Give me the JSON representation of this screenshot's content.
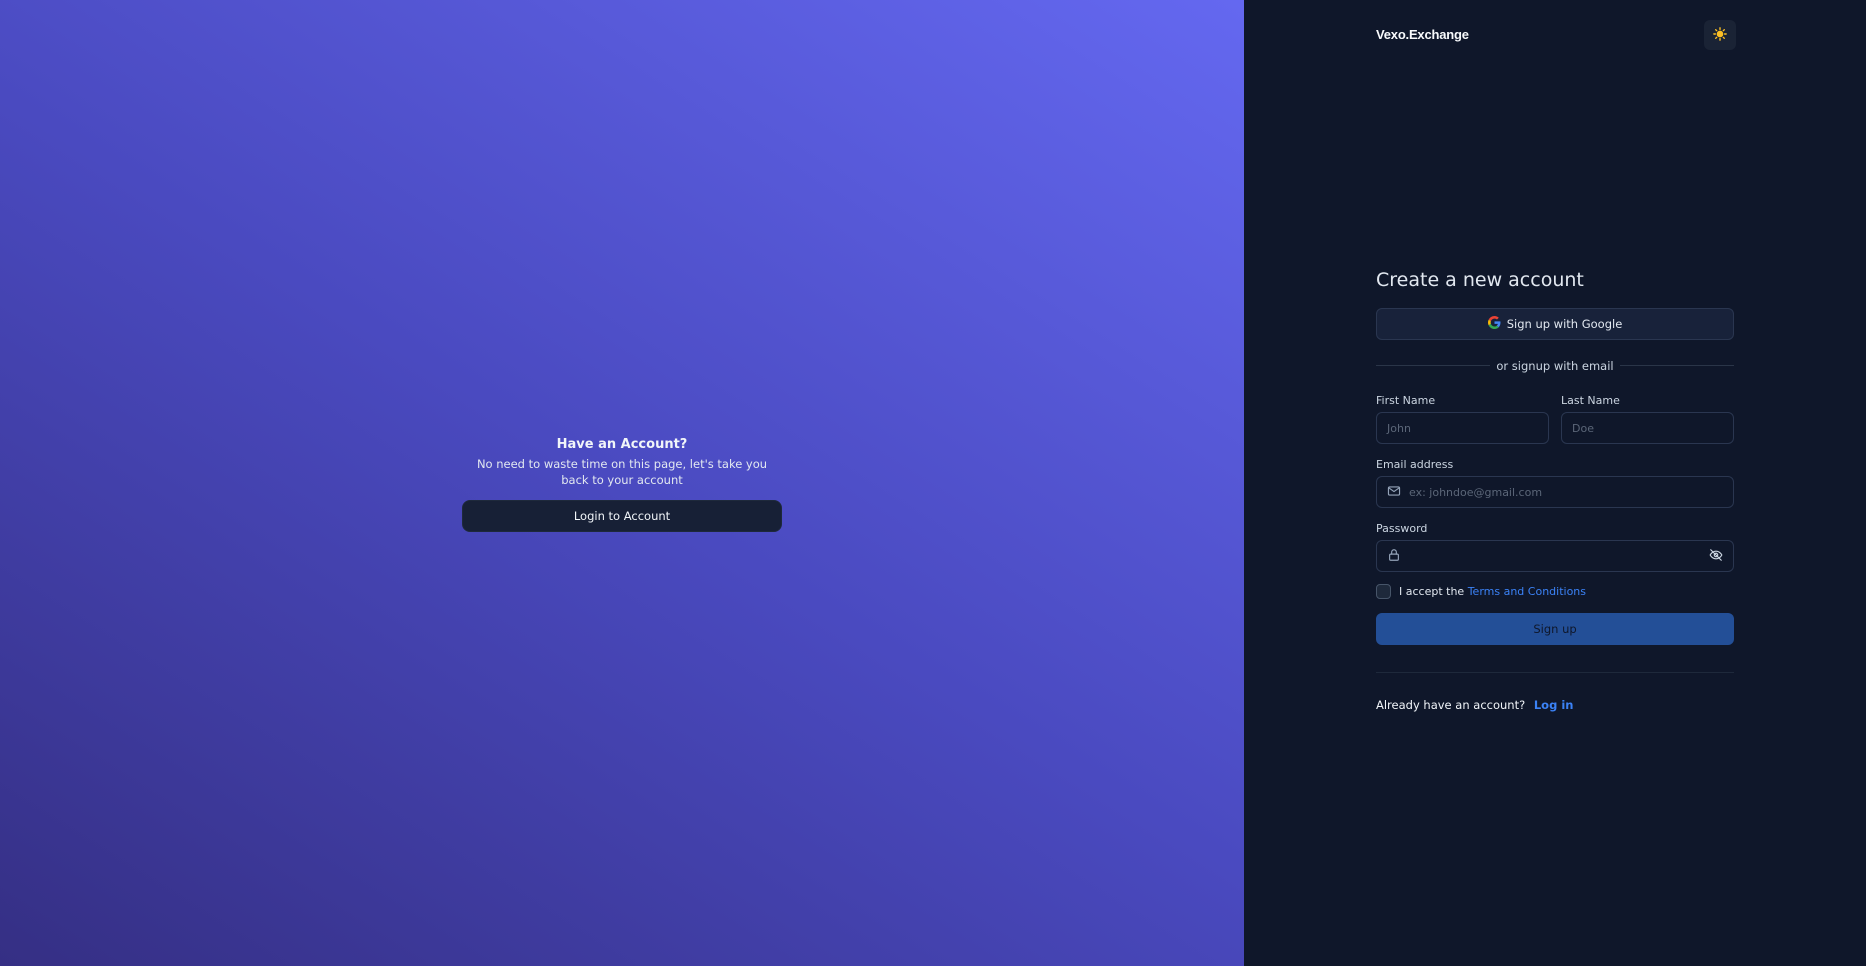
{
  "promo": {
    "title": "Have an Account?",
    "text": "No need to waste time on this page, let's take you back to your account",
    "button": "Login to Account"
  },
  "header": {
    "brand": "Vexo.Exchange",
    "theme_icon": "sun-icon"
  },
  "form": {
    "title": "Create a new account",
    "google_button": "Sign up with Google",
    "divider": "or signup with email",
    "first_name_label": "First Name",
    "first_name_placeholder": "John",
    "last_name_label": "Last Name",
    "last_name_placeholder": "Doe",
    "email_label": "Email address",
    "email_placeholder": "ex: johndoe@gmail.com",
    "password_label": "Password",
    "password_value": "",
    "terms_prefix": "I accept the",
    "terms_link": "Terms and Conditions",
    "submit": "Sign up",
    "footer_text": "Already have an account?",
    "footer_link": "Log in"
  },
  "colors": {
    "accent": "#3b82f6",
    "submit_bg": "#234f97",
    "gradient_start": "#352f84",
    "gradient_end": "#6468f0"
  }
}
